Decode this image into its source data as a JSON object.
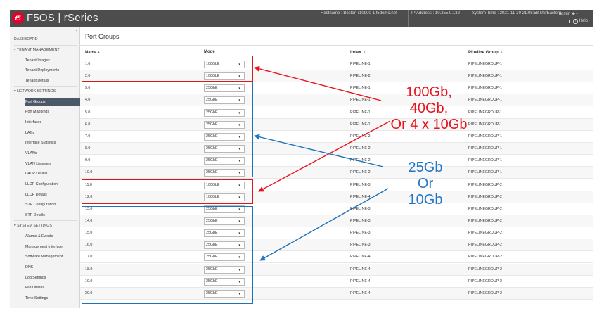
{
  "header": {
    "logo_text": "f5",
    "product": "F5OS | rSeries",
    "hostname": "Hostname : Boston-r10900-1.f5demo.net",
    "ip_address": "IP Address : 10.255.0.132",
    "system_time": "System Time : 2021-11-30 21:08:58 US/Eastern",
    "user": "admin",
    "help": "Help"
  },
  "sidebar": {
    "dashboard": "DASHBOARD",
    "sections": [
      {
        "label": "TENANT MANAGEMENT",
        "items": [
          "Tenant Images",
          "Tenant Deployments",
          "Tenant Details"
        ]
      },
      {
        "label": "NETWORK SETTINGS",
        "items": [
          "Port Groups",
          "Port Mappings",
          "Interfaces",
          "LAGs",
          "Interface Statistics",
          "VLANs",
          "VLAN Listeners",
          "LACP Details",
          "LLDP Configuration",
          "LLDP Details",
          "STP Configuration",
          "STP Details"
        ]
      },
      {
        "label": "SYSTEM SETTINGS",
        "items": [
          "Alarms & Events",
          "Management Interface",
          "Software Management",
          "DNS",
          "Log Settings",
          "File Utilities",
          "Time Settings"
        ]
      }
    ],
    "active": "Port Groups"
  },
  "main": {
    "title": "Port Groups",
    "columns": {
      "name": "Name",
      "mode": "Mode",
      "index": "Index",
      "pipeline_group": "Pipeline Group"
    },
    "rows": [
      {
        "name": "1.0",
        "mode": "100GbE",
        "index": "PIPELINE-1",
        "group": "PIPELINEGROUP-1"
      },
      {
        "name": "2.0",
        "mode": "100GbE",
        "index": "PIPELINE-2",
        "group": "PIPELINEGROUP-1"
      },
      {
        "name": "3.0",
        "mode": "25GbE",
        "index": "PIPELINE-1",
        "group": "PIPELINEGROUP-1"
      },
      {
        "name": "4.0",
        "mode": "25GbE",
        "index": "PIPELINE-1",
        "group": "PIPELINEGROUP-1"
      },
      {
        "name": "5.0",
        "mode": "25GbE",
        "index": "PIPELINE-1",
        "group": "PIPELINEGROUP-1"
      },
      {
        "name": "6.0",
        "mode": "25GbE",
        "index": "PIPELINE-1",
        "group": "PIPELINEGROUP-1"
      },
      {
        "name": "7.0",
        "mode": "25GbE",
        "index": "PIPELINE-2",
        "group": "PIPELINEGROUP-1"
      },
      {
        "name": "8.0",
        "mode": "25GbE",
        "index": "PIPELINE-2",
        "group": "PIPELINEGROUP-1"
      },
      {
        "name": "9.0",
        "mode": "25GbE",
        "index": "PIPELINE-2",
        "group": "PIPELINEGROUP-1"
      },
      {
        "name": "10.0",
        "mode": "25GbE",
        "index": "PIPELINE-2",
        "group": "PIPELINEGROUP-1"
      },
      {
        "name": "11.0",
        "mode": "100GbE",
        "index": "PIPELINE-3",
        "group": "PIPELINEGROUP-2"
      },
      {
        "name": "12.0",
        "mode": "100GbE",
        "index": "PIPELINE-4",
        "group": "PIPELINEGROUP-2"
      },
      {
        "name": "13.0",
        "mode": "25GbE",
        "index": "PIPELINE-3",
        "group": "PIPELINEGROUP-2"
      },
      {
        "name": "14.0",
        "mode": "25GbE",
        "index": "PIPELINE-3",
        "group": "PIPELINEGROUP-2"
      },
      {
        "name": "15.0",
        "mode": "25GbE",
        "index": "PIPELINE-3",
        "group": "PIPELINEGROUP-2"
      },
      {
        "name": "16.0",
        "mode": "25GbE",
        "index": "PIPELINE-3",
        "group": "PIPELINEGROUP-2"
      },
      {
        "name": "17.0",
        "mode": "25GbE",
        "index": "PIPELINE-4",
        "group": "PIPELINEGROUP-2"
      },
      {
        "name": "18.0",
        "mode": "25GbE",
        "index": "PIPELINE-4",
        "group": "PIPELINEGROUP-2"
      },
      {
        "name": "19.0",
        "mode": "25GbE",
        "index": "PIPELINE-4",
        "group": "PIPELINEGROUP-2"
      },
      {
        "name": "20.0",
        "mode": "25GbE",
        "index": "PIPELINE-4",
        "group": "PIPELINEGROUP-2"
      }
    ]
  },
  "annotations": {
    "red_text": [
      "100Gb,",
      "40Gb,",
      "Or 4 x 10Gb"
    ],
    "blue_text": [
      "25Gb",
      "Or",
      "10Gb"
    ],
    "red_color": "#e8131b",
    "blue_color": "#2276c3"
  },
  "colors": {
    "topbar": "#4d4d4d",
    "active_nav": "#4c5866",
    "brand_red": "#e4002b"
  }
}
